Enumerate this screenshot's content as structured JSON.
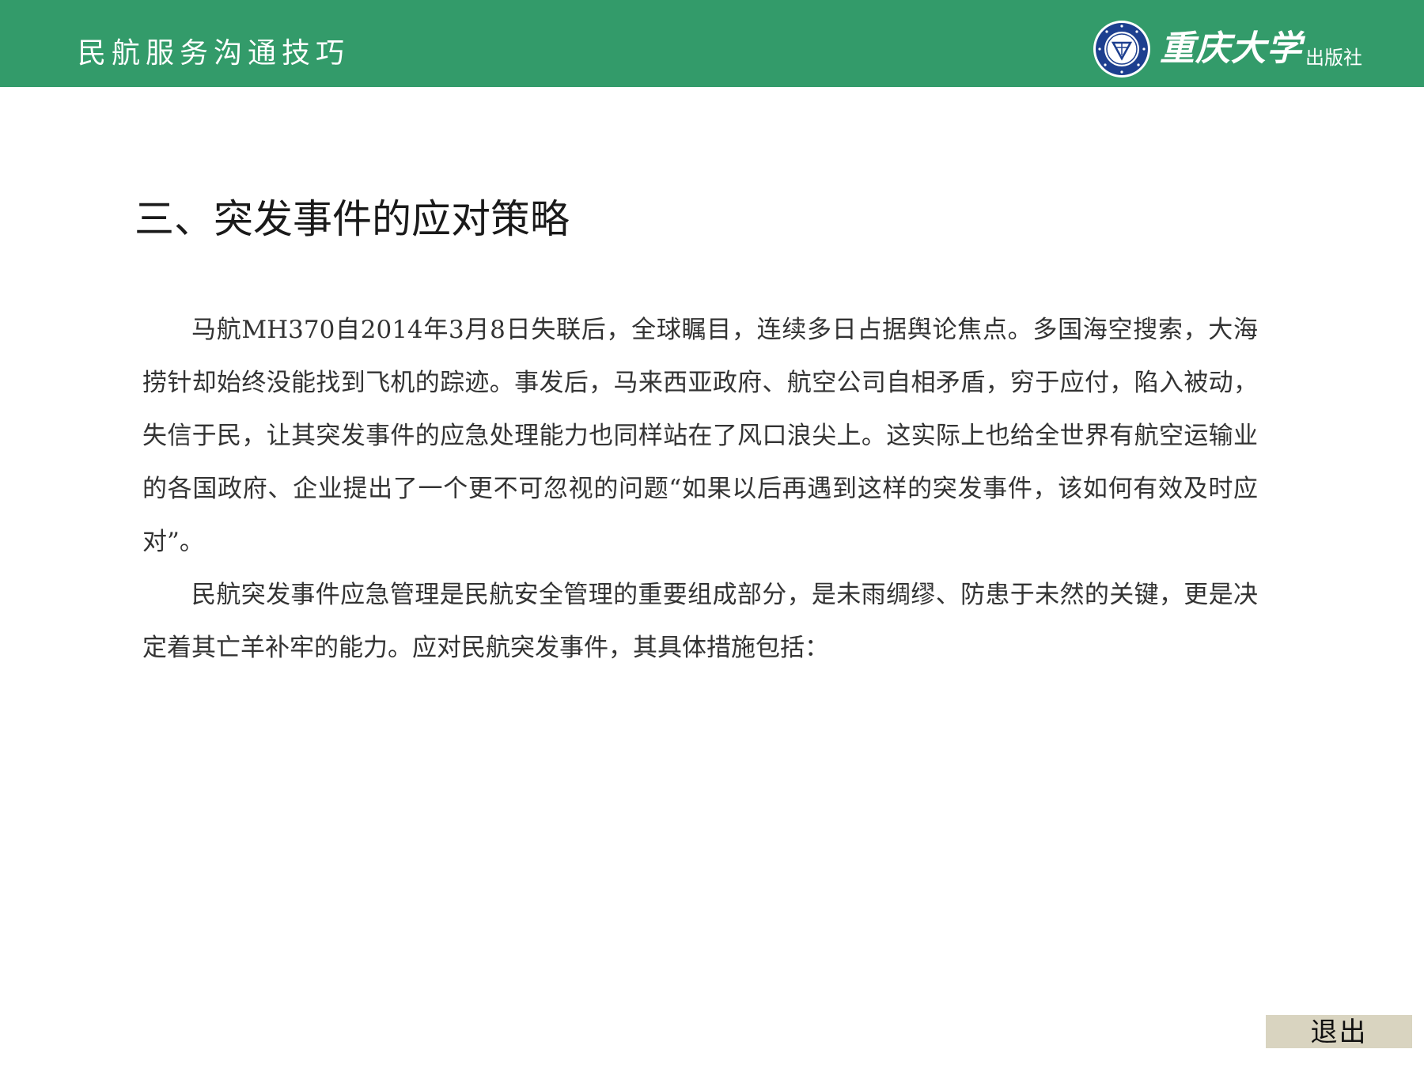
{
  "header": {
    "course_title": "民航服务沟通技巧",
    "publisher": {
      "name": "重庆大学",
      "suffix": "出版社",
      "logo_icon": "university-seal-icon"
    },
    "background_color": "#339b6a"
  },
  "main": {
    "section_heading": "三、突发事件的应对策略",
    "paragraphs": [
      "马航MH370自2014年3月8日失联后，全球瞩目，连续多日占据舆论焦点。多国海空搜索，大海捞针却始终没能找到飞机的踪迹。事发后，马来西亚政府、航空公司自相矛盾，穷于应付，陷入被动，失信于民，让其突发事件的应急处理能力也同样站在了风口浪尖上。这实际上也给全世界有航空运输业的各国政府、企业提出了一个更不可忽视的问题“如果以后再遇到这样的突发事件，该如何有效及时应对”。",
      "民航突发事件应急管理是民航安全管理的重要组成部分，是未雨绸缪、防患于未然的关键，更是决定着其亡羊补牢的能力。应对民航突发事件，其具体措施包括："
    ]
  },
  "footer": {
    "exit_label": "退出",
    "exit_button_color": "#d9d4c0"
  }
}
